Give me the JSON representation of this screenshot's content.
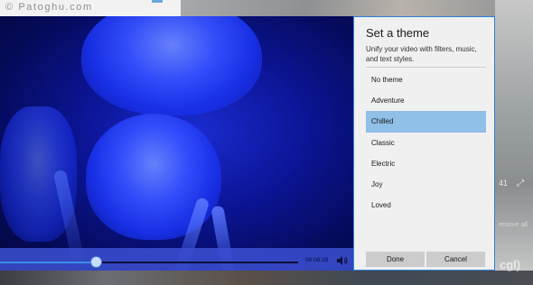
{
  "watermark": {
    "text": "© Patoghu.com"
  },
  "background": {
    "photo_count_suffix": "41",
    "remove_all_label": "emove all",
    "brand_logo": "cgl)"
  },
  "player": {
    "time": "00:00:10",
    "progress": 0.32,
    "icons": {
      "volume": "volume-icon"
    }
  },
  "theme_panel": {
    "title": "Set a theme",
    "description": "Unify your video with filters, music, and text styles.",
    "themes": [
      "No theme",
      "Adventure",
      "Chilled",
      "Classic",
      "Electric",
      "Joy",
      "Loved"
    ],
    "selected_theme": "Chilled",
    "done_label": "Done",
    "cancel_label": "Cancel"
  },
  "colors": {
    "accent_border": "#2d7fd6",
    "selected_item": "#90bfe8",
    "panel_bg": "#f0f0f0",
    "video_blue": "#1b2bd0"
  }
}
